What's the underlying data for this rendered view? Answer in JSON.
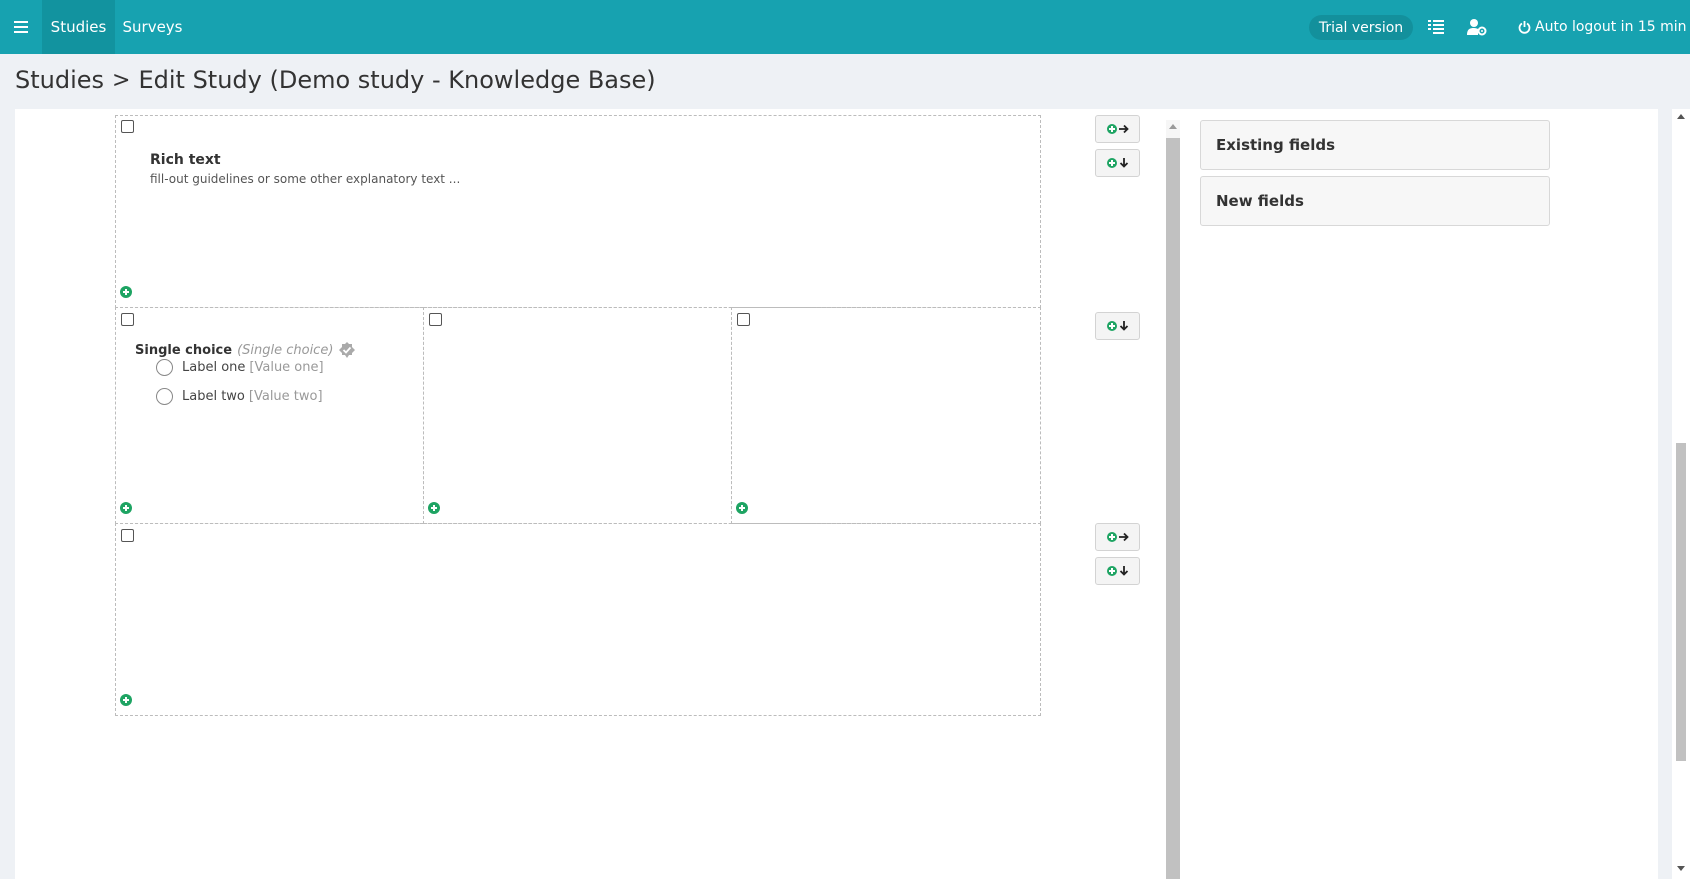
{
  "nav": {
    "studies": "Studies",
    "surveys": "Surveys",
    "trial_badge": "Trial version",
    "auto_logout": "Auto logout in 15 min"
  },
  "breadcrumb": {
    "root": "Studies",
    "separator": ">",
    "current": "Edit Study (Demo study - Knowledge Base)"
  },
  "rich_text": {
    "title": "Rich text",
    "description": "fill-out guidelines or some other explanatory text ..."
  },
  "single_choice": {
    "title": "Single choice",
    "type": "(Single choice)",
    "options": [
      {
        "label": "Label one",
        "value": "[Value one]"
      },
      {
        "label": "Label two",
        "value": "[Value two]"
      }
    ]
  },
  "accordion": {
    "existing": "Existing fields",
    "new": "New fields"
  },
  "colors": {
    "header": "#17a2b0",
    "accent_green": "#1ea463"
  }
}
